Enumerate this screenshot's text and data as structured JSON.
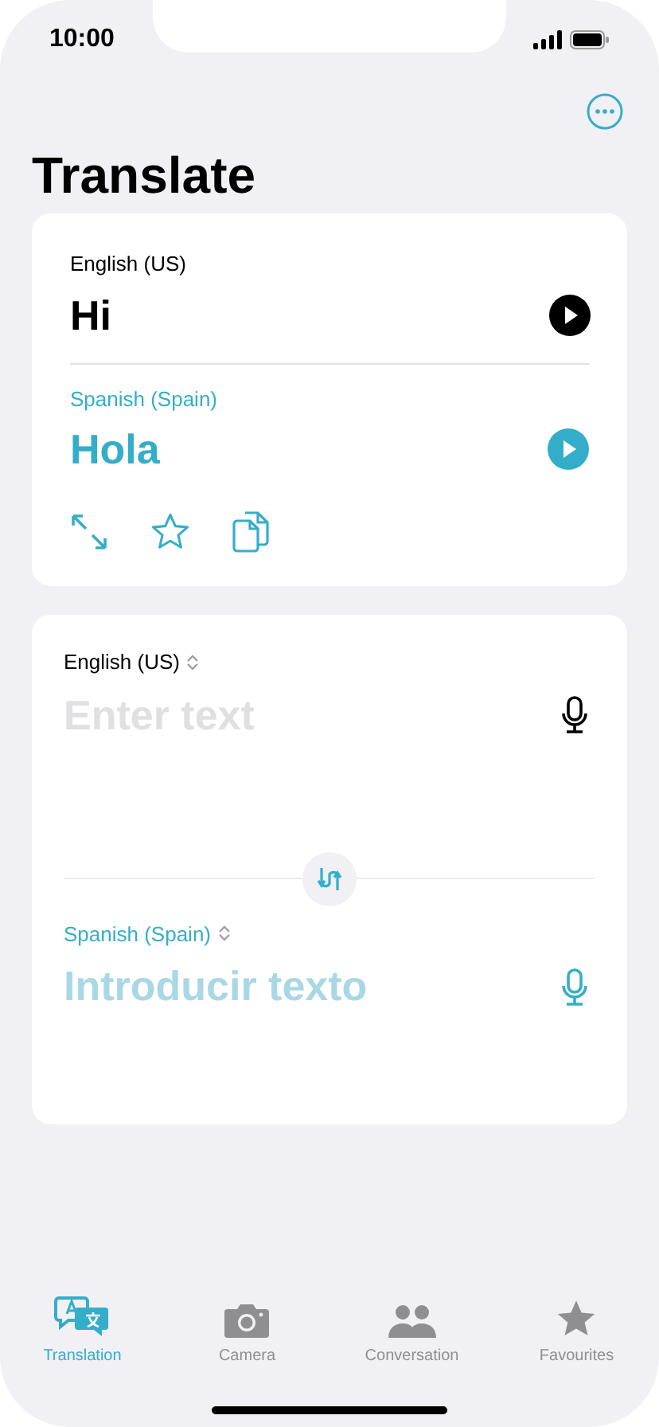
{
  "status_bar": {
    "time": "10:00"
  },
  "title": "Translate",
  "result_card": {
    "source": {
      "language": "English (US)",
      "text": "Hi"
    },
    "target": {
      "language": "Spanish (Spain)",
      "text": "Hola"
    }
  },
  "input_card": {
    "source": {
      "language": "English (US)",
      "placeholder": "Enter text"
    },
    "target": {
      "language": "Spanish (Spain)",
      "placeholder": "Introducir texto"
    }
  },
  "tabs": [
    {
      "label": "Translation",
      "kind": "translation",
      "selected": true
    },
    {
      "label": "Camera",
      "kind": "camera",
      "selected": false
    },
    {
      "label": "Conversation",
      "kind": "conversation",
      "selected": false
    },
    {
      "label": "Favourites",
      "kind": "favourites",
      "selected": false
    }
  ]
}
